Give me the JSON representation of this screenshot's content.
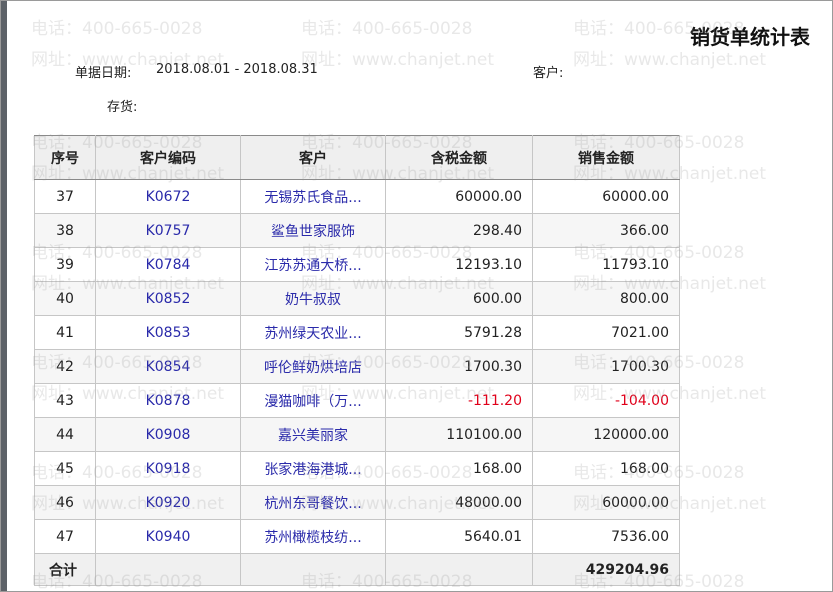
{
  "report": {
    "title": "销货单统计表",
    "date_label": "单据日期:",
    "date_value": "2018.08.01 - 2018.08.31",
    "customer_label": "客户:",
    "stock_label": "存货:"
  },
  "table": {
    "headers": [
      "序号",
      "客户编码",
      "客户",
      "含税金额",
      "销售金额"
    ],
    "rows": [
      {
        "seq": "37",
        "code": "K0672",
        "customer": "无锡苏氏食品...",
        "tax_amount": "60000.00",
        "sales_amount": "60000.00",
        "negative": false
      },
      {
        "seq": "38",
        "code": "K0757",
        "customer": "鲨鱼世家服饰",
        "tax_amount": "298.40",
        "sales_amount": "366.00",
        "negative": false
      },
      {
        "seq": "39",
        "code": "K0784",
        "customer": "江苏苏通大桥...",
        "tax_amount": "12193.10",
        "sales_amount": "11793.10",
        "negative": false
      },
      {
        "seq": "40",
        "code": "K0852",
        "customer": "奶牛叔叔",
        "tax_amount": "600.00",
        "sales_amount": "800.00",
        "negative": false
      },
      {
        "seq": "41",
        "code": "K0853",
        "customer": "苏州绿天农业...",
        "tax_amount": "5791.28",
        "sales_amount": "7021.00",
        "negative": false
      },
      {
        "seq": "42",
        "code": "K0854",
        "customer": "呼伦鲜奶烘培店",
        "tax_amount": "1700.30",
        "sales_amount": "1700.30",
        "negative": false
      },
      {
        "seq": "43",
        "code": "K0878",
        "customer": "漫猫咖啡（万...",
        "tax_amount": "-111.20",
        "sales_amount": "-104.00",
        "negative": true
      },
      {
        "seq": "44",
        "code": "K0908",
        "customer": "嘉兴美丽家",
        "tax_amount": "110100.00",
        "sales_amount": "120000.00",
        "negative": false
      },
      {
        "seq": "45",
        "code": "K0918",
        "customer": "张家港海港城...",
        "tax_amount": "168.00",
        "sales_amount": "168.00",
        "negative": false
      },
      {
        "seq": "46",
        "code": "K0920",
        "customer": "杭州东哥餐饮...",
        "tax_amount": "48000.00",
        "sales_amount": "60000.00",
        "negative": false
      },
      {
        "seq": "47",
        "code": "K0940",
        "customer": "苏州橄榄枝纺...",
        "tax_amount": "5640.01",
        "sales_amount": "7536.00",
        "negative": false
      }
    ],
    "total_label": "合计",
    "total_sales": "429204.96"
  },
  "watermark": {
    "phone": "电话：400-665-0028",
    "site": "网址：www.chanjet.net"
  },
  "colors": {
    "link_text": "#2a2aaa",
    "negative": "#e0001a",
    "header_bg": "#efefef"
  }
}
